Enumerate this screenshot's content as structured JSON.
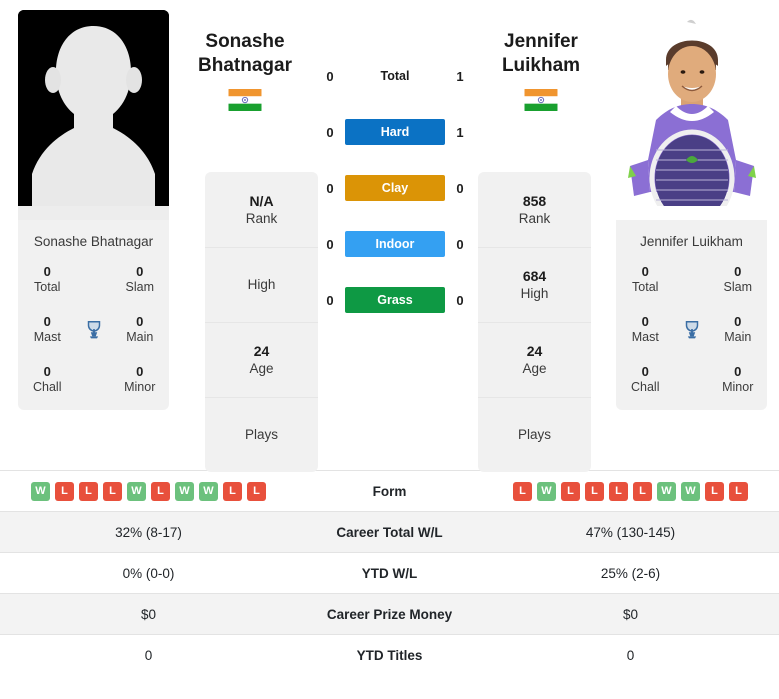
{
  "players": [
    {
      "name": "Sonashe Bhatnagar",
      "name_line1": "Sonashe",
      "name_line2": "Bhatnagar",
      "flag": "India",
      "photo": "silhouette-placeholder",
      "rank": "N/A",
      "rank_label": "Rank",
      "high": "",
      "high_label": "High",
      "age": "24",
      "age_label": "Age",
      "plays": "",
      "plays_label": "Plays",
      "titles": [
        {
          "num": "0",
          "label": "Total"
        },
        {
          "num": "0",
          "label": "Slam"
        },
        {
          "num": "0",
          "label": "Mast"
        },
        {
          "num": "0",
          "label": "Main"
        },
        {
          "num": "0",
          "label": "Chall"
        },
        {
          "num": "0",
          "label": "Minor"
        }
      ],
      "form": [
        "W",
        "L",
        "L",
        "L",
        "W",
        "L",
        "W",
        "W",
        "L",
        "L"
      ],
      "career_wl": "32% (8-17)",
      "ytd_wl": "0% (0-0)",
      "prize_money": "$0",
      "ytd_titles": "0"
    },
    {
      "name": "Jennifer Luikham",
      "name_line1": "Jennifer",
      "name_line2": "Luikham",
      "flag": "India",
      "photo": "player-photo",
      "rank": "858",
      "rank_label": "Rank",
      "high": "684",
      "high_label": "High",
      "age": "24",
      "age_label": "Age",
      "plays": "",
      "plays_label": "Plays",
      "titles": [
        {
          "num": "0",
          "label": "Total"
        },
        {
          "num": "0",
          "label": "Slam"
        },
        {
          "num": "0",
          "label": "Mast"
        },
        {
          "num": "0",
          "label": "Main"
        },
        {
          "num": "0",
          "label": "Chall"
        },
        {
          "num": "0",
          "label": "Minor"
        }
      ],
      "form": [
        "L",
        "W",
        "L",
        "L",
        "L",
        "L",
        "W",
        "W",
        "L",
        "L"
      ],
      "career_wl": "47% (130-145)",
      "ytd_wl": "25% (2-6)",
      "prize_money": "$0",
      "ytd_titles": "0"
    }
  ],
  "head_to_head": [
    {
      "label": "Total",
      "left": "0",
      "right": "1",
      "badge": false,
      "color": ""
    },
    {
      "label": "Hard",
      "left": "0",
      "right": "1",
      "badge": true,
      "color": "#0b72c4"
    },
    {
      "label": "Clay",
      "left": "0",
      "right": "0",
      "badge": true,
      "color": "#db9406"
    },
    {
      "label": "Indoor",
      "left": "0",
      "right": "0",
      "badge": true,
      "color": "#34a0f2"
    },
    {
      "label": "Grass",
      "left": "0",
      "right": "0",
      "badge": true,
      "color": "#0e9944"
    }
  ],
  "stats_rows": [
    {
      "label": "Form",
      "type": "form"
    },
    {
      "label": "Career Total W/L",
      "type": "text",
      "left": "32% (8-17)",
      "right": "47% (130-145)"
    },
    {
      "label": "YTD W/L",
      "type": "text",
      "left": "0% (0-0)",
      "right": "25% (2-6)"
    },
    {
      "label": "Career Prize Money",
      "type": "text",
      "left": "$0",
      "right": "$0"
    },
    {
      "label": "YTD Titles",
      "type": "text",
      "left": "0",
      "right": "0"
    }
  ],
  "colors": {
    "win": "#6cc17d",
    "loss": "#e8503c",
    "hard": "#0b72c4",
    "clay": "#db9406",
    "indoor": "#34a0f2",
    "grass": "#0e9944",
    "trophy": "#3b6ea5",
    "panel": "#f1f1f1"
  }
}
